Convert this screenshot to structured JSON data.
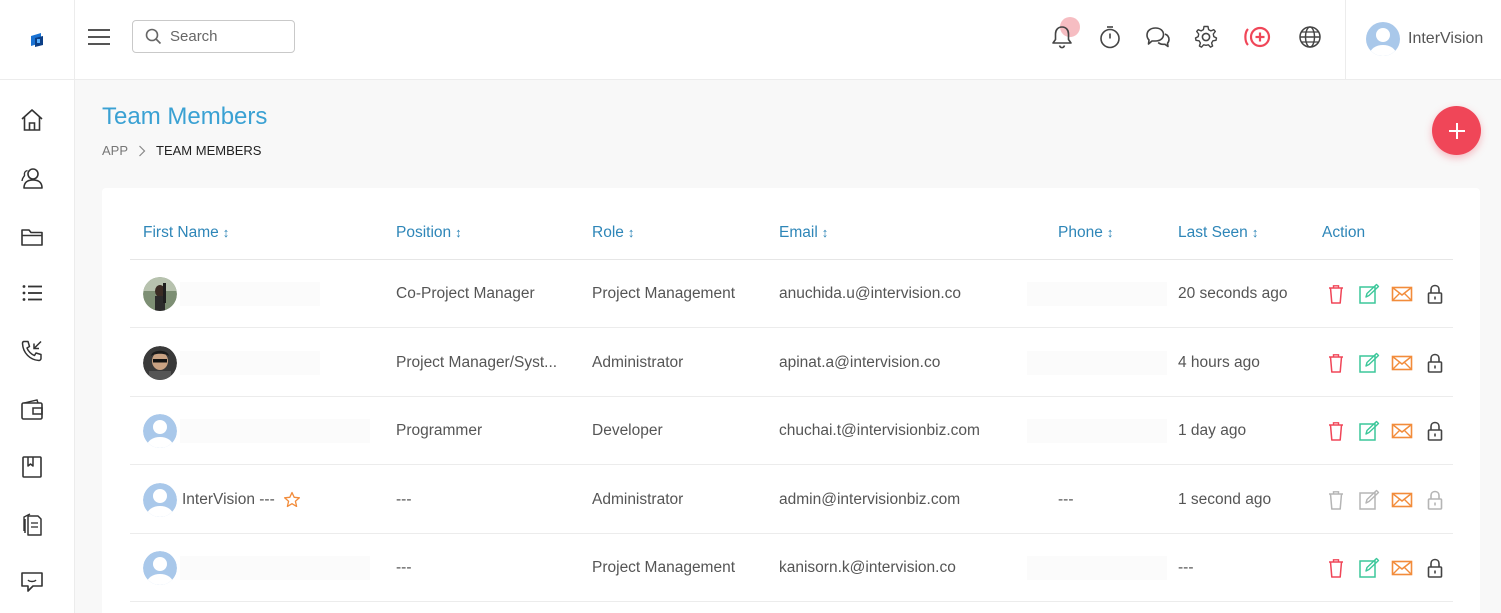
{
  "header": {
    "search_placeholder": "Search",
    "user_name": "InterVision"
  },
  "page": {
    "title": "Team Members",
    "breadcrumb": [
      "APP",
      "TEAM MEMBERS"
    ]
  },
  "table": {
    "columns": [
      "First Name",
      "Position",
      "Role",
      "Email",
      "Phone",
      "Last Seen",
      "Action"
    ],
    "sort_glyph": "↕",
    "rows": [
      {
        "name": "",
        "position": "Co-Project Manager",
        "role": "Project Management",
        "email": "anuchida.u@intervision.co",
        "phone": "",
        "last_seen": "20 seconds ago",
        "avatar": "photo-woman"
      },
      {
        "name": "",
        "position": "Project Manager/Syst...",
        "role": "Administrator",
        "email": "apinat.a@intervision.co",
        "phone": "",
        "last_seen": "4 hours ago",
        "avatar": "photo-man"
      },
      {
        "name": "",
        "position": "Programmer",
        "role": "Developer",
        "email": "chuchai.t@intervisionbiz.com",
        "phone": "",
        "last_seen": "1 day ago",
        "avatar": "default"
      },
      {
        "name": "InterVision ---",
        "position": "---",
        "role": "Administrator",
        "email": "admin@intervisionbiz.com",
        "phone": "---",
        "last_seen": "1 second ago",
        "avatar": "default"
      },
      {
        "name": "",
        "position": "---",
        "role": "Project Management",
        "email": "kanisorn.k@intervision.co",
        "phone": "",
        "last_seen": "---",
        "avatar": "default"
      }
    ]
  },
  "colors": {
    "accent_blue": "#3aa1d3",
    "header_blue": "#2e86b8",
    "delete_red": "#f04658",
    "edit_green": "#3cc79a",
    "mail_orange": "#f28c3b",
    "fab_red": "#f04658"
  },
  "icons": {
    "topbar": [
      "bell-icon",
      "timer-icon",
      "chat-icon",
      "gear-icon",
      "add-circle-icon",
      "globe-icon"
    ],
    "sidebar": [
      "home-icon",
      "users-icon",
      "folder-icon",
      "list-icon",
      "phone-icon",
      "wallet-icon",
      "book-icon",
      "document-icon",
      "feedback-icon"
    ],
    "actions": [
      "trash-icon",
      "edit-icon",
      "mail-icon",
      "lock-icon"
    ]
  }
}
